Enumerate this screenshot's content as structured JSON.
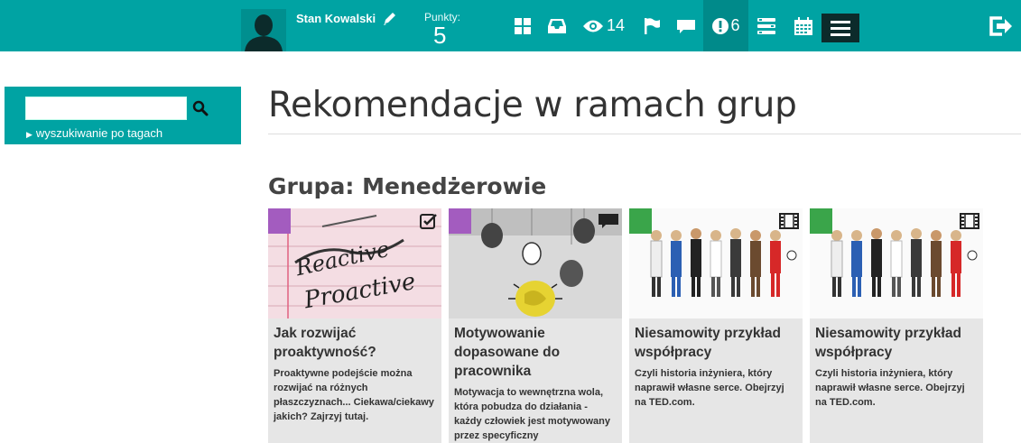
{
  "header": {
    "user_name": "Stan Kowalski",
    "points_label": "Punkty:",
    "points_value": "5",
    "views_count": "14",
    "alerts_count": "6"
  },
  "sidebar": {
    "search_placeholder": "",
    "tag_search_label": "wyszukiwanie po tagach"
  },
  "main": {
    "title": "Rekomendacje w ramach grup",
    "group_title": "Grupa: Menedżerowie",
    "cards": [
      {
        "title": "Jak rozwijać proaktywność?",
        "description": "Proaktywne podejście można rozwijać na różnych płaszczyznach... Ciekawa/ciekawy jakich? Zajrzyj tutaj.",
        "tag_color": "#a35cbf",
        "type_icon": "checklist-icon"
      },
      {
        "title": "Motywowanie dopasowane do pracownika",
        "description": "Motywacja to wewnętrzna wola, która pobudza do działania - każdy człowiek jest motywowany przez specyficzny",
        "tag_color": "#a35cbf",
        "type_icon": "comment-icon"
      },
      {
        "title": "Niesamowity przykład współpracy",
        "description": "Czyli historia inżyniera, który naprawił własne serce. Obejrzyj na TED.com.",
        "tag_color": "#3aa54a",
        "type_icon": "film-icon"
      },
      {
        "title": "Niesamowity przykład współpracy",
        "description": "Czyli historia inżyniera, który naprawił własne serce. Obejrzyj na TED.com.",
        "tag_color": "#3aa54a",
        "type_icon": "film-icon"
      }
    ]
  }
}
